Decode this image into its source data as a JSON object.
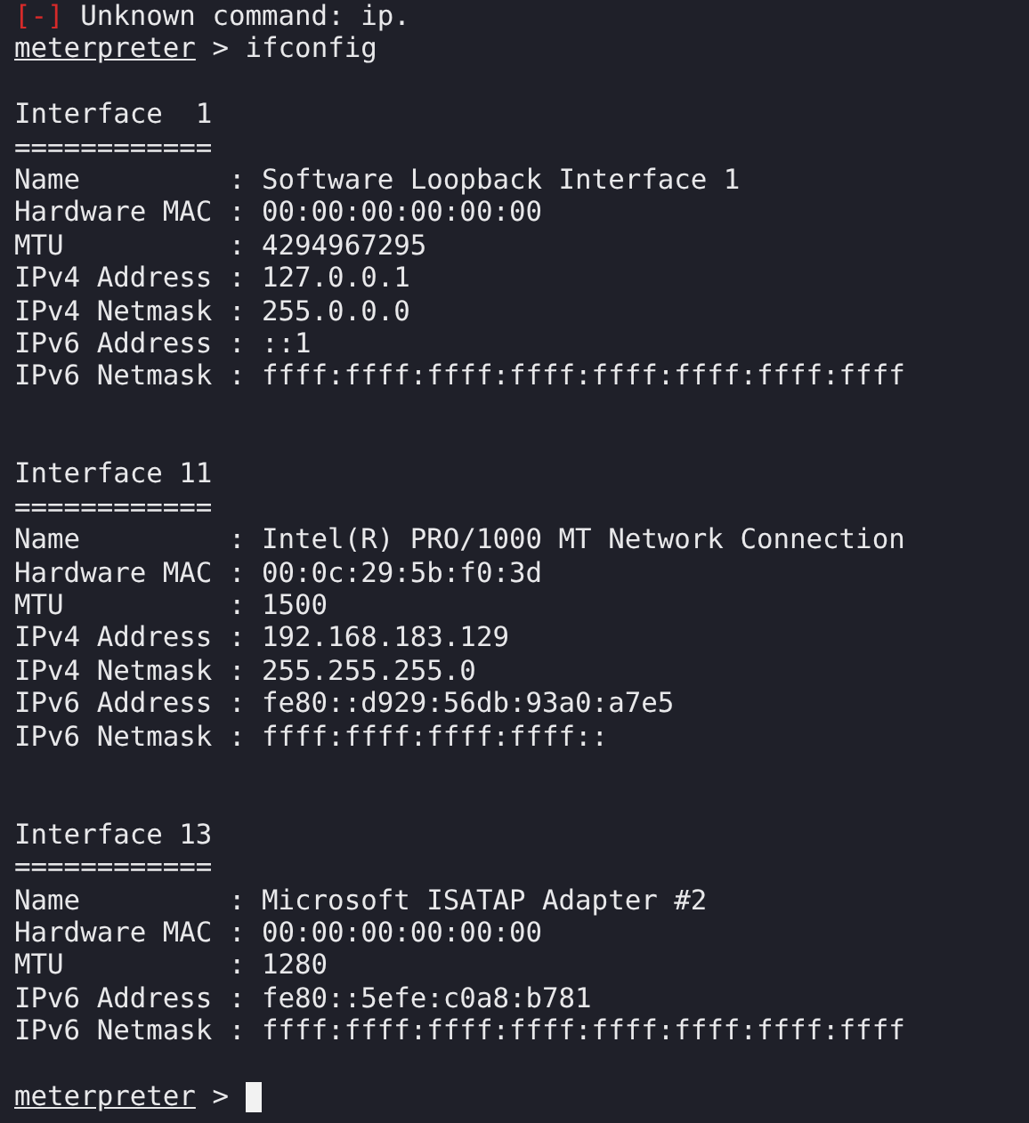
{
  "error_line": {
    "marker": "[-]",
    "text": "Unknown command: ip."
  },
  "command": {
    "prompt": "meterpreter",
    "symbol": ">",
    "text": "ifconfig"
  },
  "interfaces": [
    {
      "title": "Interface  1",
      "rule": "============",
      "separator": ":",
      "fields": [
        {
          "label": "Name",
          "value": "Software Loopback Interface 1"
        },
        {
          "label": "Hardware MAC",
          "value": "00:00:00:00:00:00"
        },
        {
          "label": "MTU",
          "value": "4294967295"
        },
        {
          "label": "IPv4 Address",
          "value": "127.0.0.1"
        },
        {
          "label": "IPv4 Netmask",
          "value": "255.0.0.0"
        },
        {
          "label": "IPv6 Address",
          "value": "::1"
        },
        {
          "label": "IPv6 Netmask",
          "value": "ffff:ffff:ffff:ffff:ffff:ffff:ffff:ffff"
        }
      ]
    },
    {
      "title": "Interface 11",
      "rule": "============",
      "separator": ":",
      "fields": [
        {
          "label": "Name",
          "value": "Intel(R) PRO/1000 MT Network Connection"
        },
        {
          "label": "Hardware MAC",
          "value": "00:0c:29:5b:f0:3d"
        },
        {
          "label": "MTU",
          "value": "1500"
        },
        {
          "label": "IPv4 Address",
          "value": "192.168.183.129"
        },
        {
          "label": "IPv4 Netmask",
          "value": "255.255.255.0"
        },
        {
          "label": "IPv6 Address",
          "value": "fe80::d929:56db:93a0:a7e5"
        },
        {
          "label": "IPv6 Netmask",
          "value": "ffff:ffff:ffff:ffff::"
        }
      ]
    },
    {
      "title": "Interface 13",
      "rule": "============",
      "separator": ":",
      "fields": [
        {
          "label": "Name",
          "value": "Microsoft ISATAP Adapter #2"
        },
        {
          "label": "Hardware MAC",
          "value": "00:00:00:00:00:00"
        },
        {
          "label": "MTU",
          "value": "1280"
        },
        {
          "label": "IPv6 Address",
          "value": "fe80::5efe:c0a8:b781"
        },
        {
          "label": "IPv6 Netmask",
          "value": "ffff:ffff:ffff:ffff:ffff:ffff:ffff:ffff"
        }
      ]
    }
  ],
  "prompt": {
    "prompt": "meterpreter",
    "symbol": ">",
    "cursor": true
  }
}
